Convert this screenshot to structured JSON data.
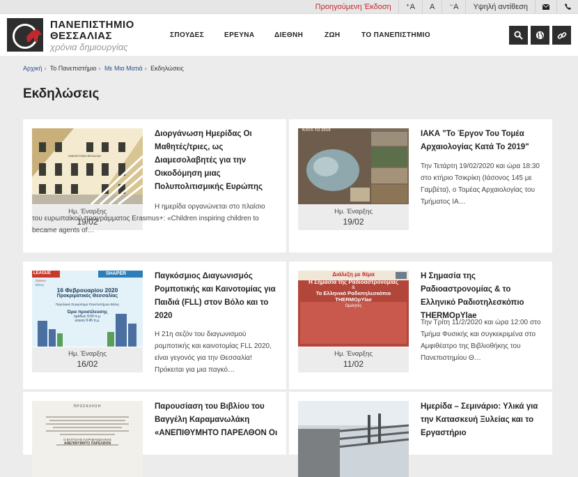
{
  "topbar": {
    "previous_version": "Προηγούμενη Έκδοση",
    "font_increase": "⁺A",
    "font_normal": "A",
    "font_decrease": "⁻A",
    "high_contrast": "Υψηλή αντίθεση"
  },
  "logo": {
    "line1": "ΠΑΝΕΠΙΣΤΗΜΙΟ",
    "line2": "ΘΕΣΣΑΛΙΑΣ",
    "tagline": "χρόνια δημιουργίας"
  },
  "nav": [
    "ΣΠΟΥΔΕΣ",
    "ΕΡΕΥΝΑ",
    "ΔΙΕΘΝΗ",
    "ΖΩΗ",
    "ΤΟ ΠΑΝΕΠΙΣΤΗΜΙΟ"
  ],
  "breadcrumb": {
    "home": "Αρχική",
    "university": "Το Πανεπιστήμιο",
    "glance": "Με Μια Ματιά",
    "current": "Εκδηλώσεις"
  },
  "page_title": "Εκδηλώσεις",
  "date_label": "Ημ. Έναρξης",
  "events": [
    {
      "title": "Διοργάνωση Ημερίδας Οι Μαθητές/τριες, ως Διαμεσολαβητές για την Οικοδόμηση μιας Πολυπολιτισμικής Ευρώπης",
      "description": "Η ημερίδα οργανώνεται στο πλαίσιο του ευρωπαϊκού προγράμματος Erasmus+: «Children inspiring children to became agents of…",
      "date": "19/02",
      "thumb_text": "ΠΑΝΕΠΙΣΤΗΜΙΟ ΘΕΣΣΑΛΙΑΣ"
    },
    {
      "title": "ΙΑΚΑ \"Το Έργον Του Τομέα Αρχαιολογίας Κατά Το 2019\"",
      "description": "Την Τετάρτη 19/02/2020 και ώρα 18:30 στο κτήριο Τσικρίκη (Ιάσονος 145 με Γαμβέτα), ο Τομέας Αρχαιολογίας του Τμήματος ΙΑ…",
      "date": "19/02",
      "thumb_text": "ΚΑΤΑ ΤΟ 2019"
    },
    {
      "title": "Παγκόσμιος Διαγωνισμός Ρομποτικής και Καινοτομίας για Παιδιά (FLL) στον Βόλο και το 2020",
      "description": "Η 21η σεζόν του διαγωνισμού ρομποτικής και καινοτομίας FLL 2020, είναι γεγονός για την Θεσσαλία! Πρόκειται για μια παγκό…",
      "date": "16/02",
      "thumb_lines": [
        "16 Φεβρουαρίου 2020",
        "Προκριματικός Θεσσαλίας",
        "Παρολιακό Συγκρότημα Πανεπιστήμιου Βόλος",
        "Ώρα προσέλευσης",
        "ομάδων 9:00 π.μ.",
        "κοινού 9:45 π.μ."
      ],
      "thumb_tags": [
        "LEAGUE",
        "SHAPER",
        "Greece",
        "Βόλος"
      ]
    },
    {
      "title": "Η Σημασία της Ραδιοαστρονομίας & το Ελληνικό Ραδιοτηλεσκόπιο THERMOpYlae",
      "description": "Την Τρίτη  11/2/2020 και ώρα 12:00 στο Τμήμα Φυσικής και συγκεκριμένα στο Αμφιθέατρο της Βιβλιοθήκης του Πανεπιστημίου Θ…",
      "date": "11/02",
      "thumb_lines": [
        "Διάλεξη με θέμα",
        "Η Σημασία της Ραδιοαστρονομίας",
        "&",
        "Το Ελληνικό Ραδιοτηλεσκόπιο",
        "THERMOpYlae",
        "Ομιλητές"
      ]
    },
    {
      "title": "Παρουσίαση του Βιβλίου του Βαγγέλη Καραμανωλάκη «ΑΝΕΠΙΘΥΜΗΤΟ ΠΑΡΕΛΘΟΝ Οι",
      "description": "",
      "date": "",
      "thumb_lines": [
        "ΠΡΟΣΚΛΗΣΗ",
        "Ο ΒΑΓΓΕΛΗΣ ΚΑΡΑΜΑΝΩΛΑΚΗΣ",
        "ΑΝΕΠΙΘΥΜΗΤΟ ΠΑΡΕΛΘΟΝ"
      ]
    },
    {
      "title": "Ημερίδα – Σεμινάριο: Υλικά για την Κατασκευή Ξυλείας και το Εργαστήριο",
      "description": "",
      "date": ""
    }
  ],
  "colors": {
    "accent_red": "#c0282d",
    "dark": "#2d2d2d",
    "link_blue": "#2a4f86",
    "bg": "#ececec"
  }
}
